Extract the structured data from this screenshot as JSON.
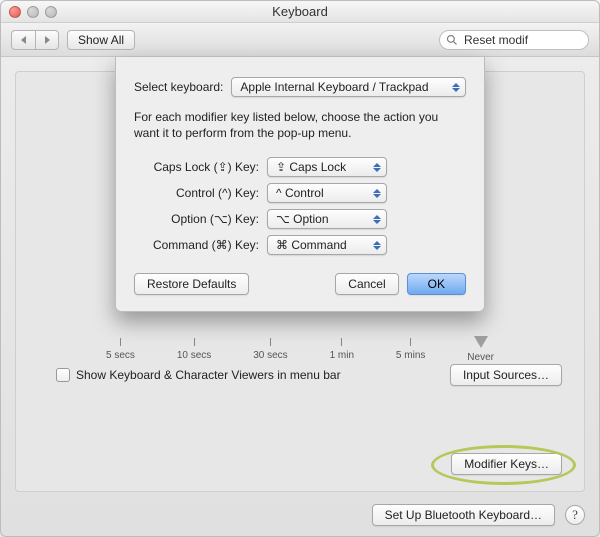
{
  "window": {
    "title": "Keyboard"
  },
  "toolbar": {
    "show_all": "Show All",
    "search_value": "Reset modif"
  },
  "sheet": {
    "select_keyboard_label": "Select keyboard:",
    "select_keyboard_value": "Apple Internal Keyboard / Trackpad",
    "description": "For each modifier key listed below, choose the action you want it to perform from the pop-up menu.",
    "rows": [
      {
        "label": "Caps Lock (⇪) Key:",
        "value": "⇪ Caps Lock"
      },
      {
        "label": "Control (^) Key:",
        "value": "^ Control"
      },
      {
        "label": "Option (⌥) Key:",
        "value": "⌥ Option"
      },
      {
        "label": "Command (⌘) Key:",
        "value": "⌘ Command"
      }
    ],
    "restore_defaults": "Restore Defaults",
    "cancel": "Cancel",
    "ok": "OK"
  },
  "background": {
    "ticks": [
      "5 secs",
      "10 secs",
      "30 secs",
      "1 min",
      "5 mins",
      "Never"
    ],
    "selected_tick_index": 5,
    "show_viewers_checkbox": "Show Keyboard & Character Viewers in menu bar",
    "input_sources": "Input Sources…",
    "modifier_keys": "Modifier Keys…"
  },
  "footer": {
    "bluetooth": "Set Up Bluetooth Keyboard…"
  }
}
